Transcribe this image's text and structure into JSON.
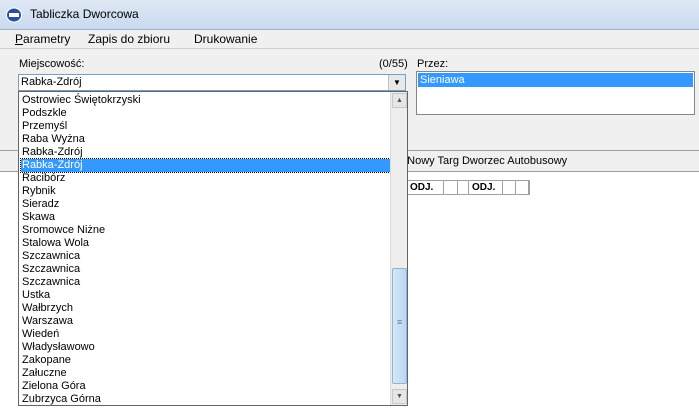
{
  "window": {
    "title": "Tabliczka Dworcowa"
  },
  "menu": {
    "parametry": {
      "first": "P",
      "rest": "arametry"
    },
    "zapis": "Zapis do zbioru",
    "drukowanie": "Drukowanie"
  },
  "form": {
    "miejscowosc_label": "Miejscowość:",
    "count": "(0/55)",
    "combo_value": "Rabka-Zdrój",
    "przez_label": "Przez:",
    "przez_selected": "Sieniawa"
  },
  "route": {
    "text": "a Nowy Targ Dworzec Autobusowy"
  },
  "grid": {
    "col1": "ODJ.",
    "col2": "ODJ."
  },
  "dropdown": {
    "items": [
      "Ostrowiec Świętokrzyski",
      "Podszkle",
      "Przemyśl",
      "Raba Wyżna",
      "Rabka-Zdrój",
      "Rabka-Zdrój",
      "Racibórz",
      "Rybnik",
      "Sieradz",
      "Skawa",
      "Sromowce Niżne",
      "Stalowa Wola",
      "Szczawnica",
      "Szczawnica",
      "Szczawnica",
      "Ustka",
      "Wałbrzych",
      "Warszawa",
      "Wiedeń",
      "Władysławowo",
      "Zakopane",
      "Załuczne",
      "Zielona Góra",
      "Zubrzyca Górna"
    ],
    "selected_index": 5
  }
}
